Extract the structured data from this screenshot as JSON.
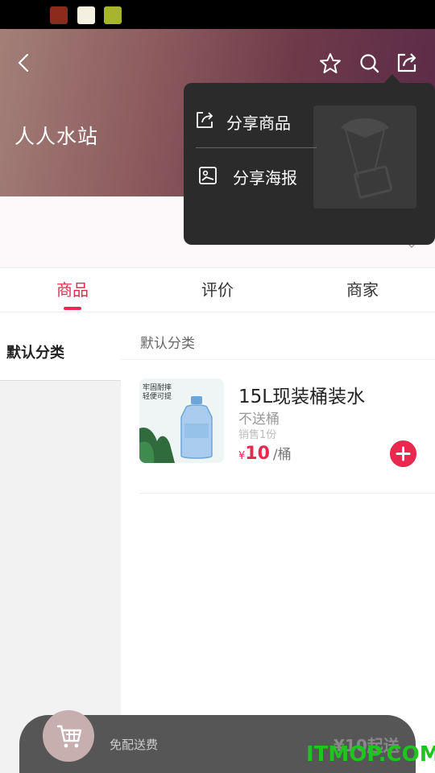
{
  "app": {
    "store_name": "人人水站"
  },
  "tabs": [
    {
      "label": "商品",
      "active": true
    },
    {
      "label": "评价",
      "active": false
    },
    {
      "label": "商家",
      "active": false
    }
  ],
  "sidebar": {
    "items": [
      {
        "label": "默认分类",
        "selected": true
      }
    ]
  },
  "category": {
    "header": "默认分类"
  },
  "product": {
    "image_caption_line1": "牢固耐摔",
    "image_caption_line2": "轻便可提",
    "title": "15L现装桶装水",
    "subtitle": "不送桶",
    "sales": "销售1份",
    "currency": "¥",
    "price": "10",
    "unit": "/桶"
  },
  "cart": {
    "free_delivery": "免配送费",
    "min_order": "¥10起送"
  },
  "share_menu": {
    "items": [
      {
        "label": "分享商品",
        "icon": "share-icon"
      },
      {
        "label": "分享海报",
        "icon": "image-icon"
      }
    ]
  },
  "watermark": "ITMOP.COM",
  "colors": {
    "accent": "#e8284f",
    "popover_bg": "#2b2b2b",
    "cart_bar": "#565656"
  }
}
